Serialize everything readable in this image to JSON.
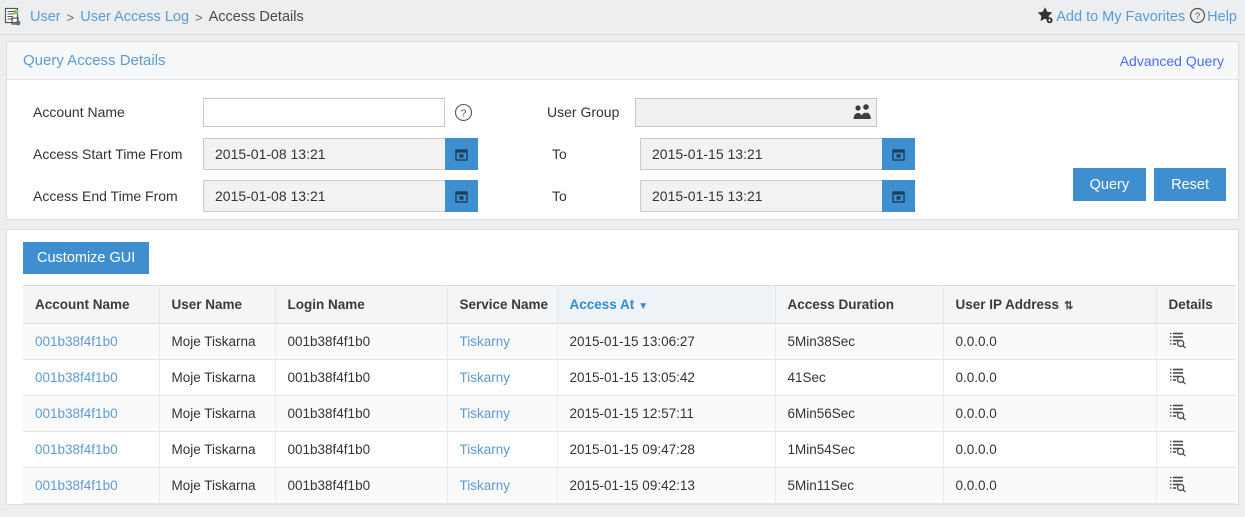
{
  "breadcrumb": {
    "icon": "report-icon",
    "items": [
      {
        "label": "User",
        "link": true
      },
      {
        "label": "User Access Log",
        "link": true
      },
      {
        "label": "Access Details",
        "link": false
      }
    ],
    "separator": ">"
  },
  "topbar": {
    "favorites_label": "Add to My Favorites",
    "favorites_icon": "star-icon",
    "help_label": "Help",
    "help_icon": "question-circle-icon"
  },
  "query_panel": {
    "title": "Query Access Details",
    "advanced_link": "Advanced Query",
    "fields": {
      "account_name_label": "Account Name",
      "account_name_value": "",
      "account_name_hint_icon": "question-circle-icon",
      "user_group_label": "User Group",
      "user_group_value": "",
      "user_group_picker_icon": "user-group-icon",
      "start_time_label": "Access Start Time From",
      "start_time_from": "2015-01-08 13:21",
      "start_time_to_label": "To",
      "start_time_to": "2015-01-15 13:21",
      "end_time_label": "Access End Time From",
      "end_time_from": "2015-01-08 13:21",
      "end_time_to_label": "To",
      "end_time_to": "2015-01-15 13:21",
      "calendar_icon": "calendar-icon"
    },
    "query_button": "Query",
    "reset_button": "Reset"
  },
  "results_panel": {
    "customize_button": "Customize GUI",
    "columns": [
      {
        "label": "Account Name",
        "sort": "none"
      },
      {
        "label": "User Name",
        "sort": "none"
      },
      {
        "label": "Login Name",
        "sort": "none"
      },
      {
        "label": "Service Name",
        "sort": "none"
      },
      {
        "label": "Access At",
        "sort": "desc"
      },
      {
        "label": "Access Duration",
        "sort": "none"
      },
      {
        "label": "User IP Address",
        "sort": "sortable"
      },
      {
        "label": "Details",
        "sort": "none"
      }
    ],
    "sort_desc_glyph": "▼",
    "sort_both_glyph": "⇅",
    "details_icon": "list-search-icon",
    "rows": [
      {
        "account": "001b38f4f1b0",
        "user": "Moje Tiskarna",
        "login": "001b38f4f1b0",
        "service": "Tiskarny",
        "access_at": "2015-01-15 13:06:27",
        "duration": "5Min38Sec",
        "ip": "0.0.0.0"
      },
      {
        "account": "001b38f4f1b0",
        "user": "Moje Tiskarna",
        "login": "001b38f4f1b0",
        "service": "Tiskarny",
        "access_at": "2015-01-15 13:05:42",
        "duration": "41Sec",
        "ip": "0.0.0.0"
      },
      {
        "account": "001b38f4f1b0",
        "user": "Moje Tiskarna",
        "login": "001b38f4f1b0",
        "service": "Tiskarny",
        "access_at": "2015-01-15 12:57:11",
        "duration": "6Min56Sec",
        "ip": "0.0.0.0"
      },
      {
        "account": "001b38f4f1b0",
        "user": "Moje Tiskarna",
        "login": "001b38f4f1b0",
        "service": "Tiskarny",
        "access_at": "2015-01-15 09:47:28",
        "duration": "1Min54Sec",
        "ip": "0.0.0.0"
      },
      {
        "account": "001b38f4f1b0",
        "user": "Moje Tiskarna",
        "login": "001b38f4f1b0",
        "service": "Tiskarny",
        "access_at": "2015-01-15 09:42:13",
        "duration": "5Min11Sec",
        "ip": "0.0.0.0"
      }
    ]
  },
  "colors": {
    "accent_blue": "#3f8fd0",
    "link_blue": "#5b9bd5",
    "advanced_blue": "#4a6cf7",
    "page_bg": "#eceeef"
  }
}
